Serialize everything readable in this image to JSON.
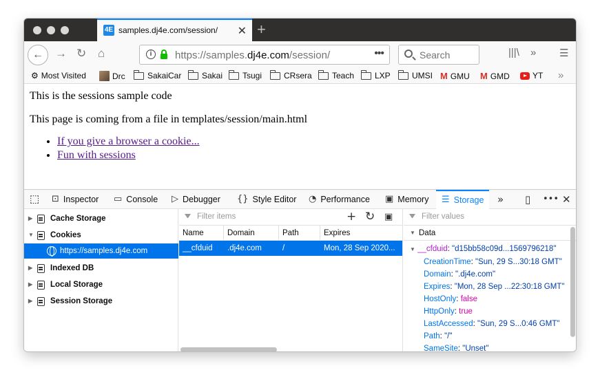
{
  "tab": {
    "title": "samples.dj4e.com/session/",
    "favicon": "4E"
  },
  "urlbar": {
    "prefix": "https://samples.",
    "host": "dj4e.com",
    "path": "/session/",
    "more": "•••"
  },
  "search": {
    "placeholder": "Search"
  },
  "bookmarks": [
    {
      "label": "Most Visited",
      "icon": "gear-icon"
    },
    {
      "label": "Drc",
      "icon": "avatar"
    },
    {
      "label": "SakaiCar",
      "icon": "folder-icon"
    },
    {
      "label": "Sakai",
      "icon": "folder-icon"
    },
    {
      "label": "Tsugi",
      "icon": "folder-icon"
    },
    {
      "label": "CRsera",
      "icon": "folder-icon"
    },
    {
      "label": "Teach",
      "icon": "folder-icon"
    },
    {
      "label": "LXP",
      "icon": "folder-icon"
    },
    {
      "label": "UMSI",
      "icon": "folder-icon"
    },
    {
      "label": "GMU",
      "icon": "gmail-icon"
    },
    {
      "label": "GMD",
      "icon": "gmail-icon"
    },
    {
      "label": "YT",
      "icon": "youtube-icon"
    }
  ],
  "page": {
    "line1": "This is the sessions sample code",
    "line2": "This page is coming from a file in templates/session/main.html",
    "links": [
      "If you give a browser a cookie...",
      "Fun with sessions"
    ]
  },
  "devtools": {
    "tabs": [
      "Inspector",
      "Console",
      "Debugger",
      "Style Editor",
      "Performance",
      "Memory",
      "Storage"
    ],
    "active_tab": "Storage",
    "sidebar": {
      "cache": "Cache Storage",
      "cookies": "Cookies",
      "cookie_host": "https://samples.dj4e.com",
      "indexed": "Indexed DB",
      "local": "Local Storage",
      "session": "Session Storage"
    },
    "filter_items": "Filter items",
    "filter_values": "Filter values",
    "columns": [
      "Name",
      "Domain",
      "Path",
      "Expires"
    ],
    "row": {
      "name": "__cfduid",
      "domain": ".dj4e.com",
      "path": "/",
      "expires": "Mon, 28 Sep 2020..."
    },
    "data": {
      "header": "Data",
      "root_key": "__cfduid",
      "root_val": "\"d15bb58c09d...1569796218\"",
      "creation_key": "CreationTime",
      "creation_val": "\"Sun, 29 S...30:18 GMT\"",
      "domain_key": "Domain",
      "domain_val": "\".dj4e.com\"",
      "expires_key": "Expires",
      "expires_val": "\"Mon, 28 Sep ...22:30:18 GMT\"",
      "hostonly_key": "HostOnly",
      "hostonly_val": "false",
      "httponly_key": "HttpOnly",
      "httponly_val": "true",
      "lastacc_key": "LastAccessed",
      "lastacc_val": "\"Sun, 29 S...0:46 GMT\"",
      "path_key": "Path",
      "path_val": "\"/\"",
      "samesite_key": "SameSite",
      "samesite_val": "\"Unset\""
    }
  }
}
